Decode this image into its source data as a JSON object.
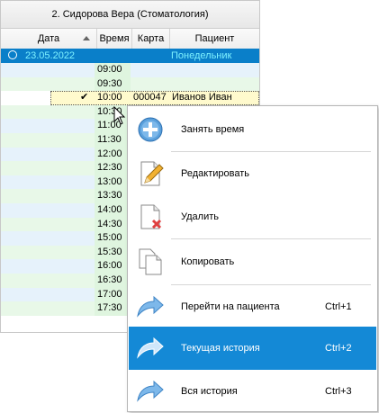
{
  "panel": {
    "title": "2. Сидорова Вера (Стоматология)",
    "columns": [
      "Дата",
      "Время",
      "Карта",
      "Пациент"
    ],
    "group": {
      "date": "23.05.2022",
      "day": "Понедельник"
    },
    "rows": [
      {
        "time": "09:00"
      },
      {
        "time": "09:30"
      },
      {
        "time": "10:00",
        "check": "✔",
        "card": "000047",
        "patient": "Иванов Иван",
        "selected": true
      },
      {
        "time": "10:30"
      },
      {
        "time": "11:00"
      },
      {
        "time": "11:30"
      },
      {
        "time": "12:00"
      },
      {
        "time": "12:30"
      },
      {
        "time": "13:00"
      },
      {
        "time": "13:30"
      },
      {
        "time": "14:00"
      },
      {
        "time": "14:30"
      },
      {
        "time": "15:00"
      },
      {
        "time": "15:30"
      },
      {
        "time": "16:00"
      },
      {
        "time": "16:30"
      },
      {
        "time": "17:00"
      },
      {
        "time": "17:30"
      }
    ]
  },
  "menu": {
    "items": [
      {
        "label": "Занять время",
        "icon": "plus-icon",
        "shortcut": ""
      },
      {
        "label": "Редактировать",
        "icon": "edit-icon",
        "shortcut": ""
      },
      {
        "label": "Удалить",
        "icon": "delete-icon",
        "shortcut": ""
      },
      {
        "label": "Копировать",
        "icon": "copy-icon",
        "shortcut": ""
      },
      {
        "label": "Перейти на пациента",
        "icon": "arrow-icon",
        "shortcut": "Ctrl+1"
      },
      {
        "label": "Текущая история",
        "icon": "arrow-icon",
        "shortcut": "Ctrl+2",
        "highlighted": true
      },
      {
        "label": "Вся история",
        "icon": "arrow-icon",
        "shortcut": "Ctrl+3"
      }
    ]
  },
  "colors": {
    "group_bg": "#0a7fc9",
    "highlight": "#1489d6",
    "row_green": "#e8f8e8",
    "row_blue": "#e6f2fb",
    "time_cell_green": "#dff5df"
  }
}
